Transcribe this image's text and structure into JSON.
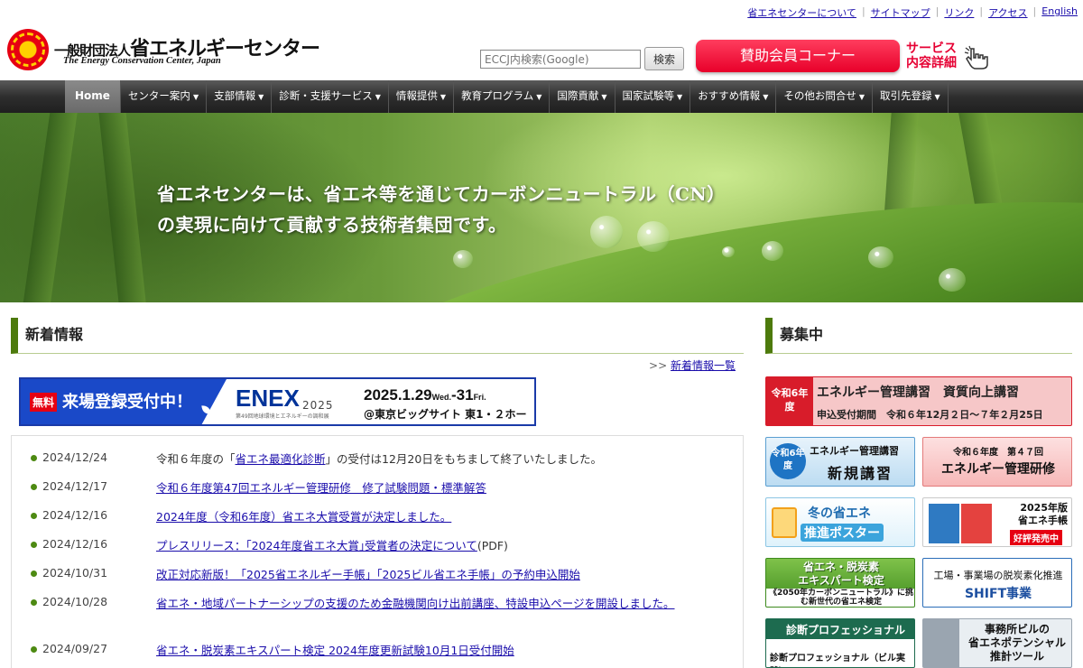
{
  "util_links": [
    "省エネセンターについて",
    "サイトマップ",
    "リンク",
    "アクセス",
    "English"
  ],
  "org": {
    "name_prefix": "一般財団法人",
    "name_main": "省エネルギーセンター",
    "name_en": "The Energy Conservation Center, Japan"
  },
  "search": {
    "placeholder": "ECCJ内検索(Google)",
    "button_label": "検索"
  },
  "header": {
    "sponsor_button": "賛助会員コーナー",
    "service_line1": "サービス",
    "service_line2": "内容詳細"
  },
  "nav": {
    "home": "Home",
    "items": [
      "センター案内",
      "支部情報",
      "診断・支援サービス",
      "情報提供",
      "教育プログラム",
      "国際貢献",
      "国家試験等",
      "おすすめ情報",
      "その他お問合せ",
      "取引先登録"
    ]
  },
  "hero": {
    "line1": "省エネセンターは、省エネ等を通じてカーボンニュートラル（CN）",
    "line2": "の実現に向けて貢献する技術者集団です。"
  },
  "news": {
    "title": "新着情報",
    "more_prefix": ">>",
    "more_link": "新着情報一覧",
    "items": [
      {
        "date": "2024/12/24",
        "pre": "令和６年度の「",
        "link": "省エネ最適化診断",
        "post": "」の受付は12月20日をもちまして終了いたしました。"
      },
      {
        "date": "2024/12/17",
        "pre": "",
        "link": "令和６年度第47回エネルギー管理研修　修了試験問題・標準解答",
        "post": ""
      },
      {
        "date": "2024/12/16",
        "pre": "",
        "link": "2024年度（令和6年度）省エネ大賞受賞が決定しました。",
        "post": ""
      },
      {
        "date": "2024/12/16",
        "pre": "",
        "link": "プレスリリース：｢2024年度省エネ大賞｣受賞者の決定について",
        "post": "(PDF)"
      },
      {
        "date": "2024/10/31",
        "pre": "",
        "link": "改正対応新版！「2025省エネルギー手帳」「2025ビル省エネ手帳」の予約申込開始",
        "post": ""
      },
      {
        "date": "2024/10/28",
        "pre": "",
        "link": "省エネ・地域パートナーシップの支援のため金融機関向け出前講座、特設申込ページを開設しました。",
        "post": ""
      },
      {
        "date": "2024/09/27",
        "pre": "",
        "link": "省エネ・脱炭素エキスパート検定 2024年度更新試験10月1日受付開始",
        "post": ""
      }
    ]
  },
  "enex": {
    "free": "無料",
    "registration": "来場登録受付中！",
    "logo": "ENEX",
    "year": "2025",
    "subtitle": "第49回地球環境とエネルギーの調和展",
    "date_start": "2025.1.29",
    "day_start": "Wed.",
    "date_end": "-31",
    "day_end": "Fri.",
    "venue": "@東京ビッグサイト 東1・２ホール"
  },
  "recruit": {
    "title": "募集中",
    "mgmt": {
      "year": "令和6年度",
      "title": "エネルギー管理講習　資質向上講習",
      "period": "申込受付期間　令和６年12月２日～７年２月25日"
    },
    "new_course": {
      "year": "令和6年度",
      "title": "エネルギー管理講習",
      "sub": "新規講習"
    },
    "training": {
      "title": "令和６年度　第４７回",
      "sub": "エネルギー管理研修"
    },
    "winter": {
      "title": "冬の省エネ",
      "sub": "推進ポスター"
    },
    "book": {
      "title": "2025年版",
      "title2": "省エネ手帳",
      "badge": "好評発売中"
    },
    "expert": {
      "title": "省エネ・脱炭素",
      "title2": "エキスパート検定",
      "sub": "《2050年カーボンニュートラル》に挑む新世代の省エネ検定"
    },
    "shift": {
      "title": "工場・事業場の脱炭素化推進",
      "sub": "SHIFT事業"
    },
    "diag": {
      "title": "診断プロフェッショナル",
      "sub": "診断プロフェッショナル（ビル実践）"
    },
    "office": {
      "title": "事務所ビルの",
      "title2": "省エネポテンシャル",
      "title3": "推計ツール"
    }
  }
}
